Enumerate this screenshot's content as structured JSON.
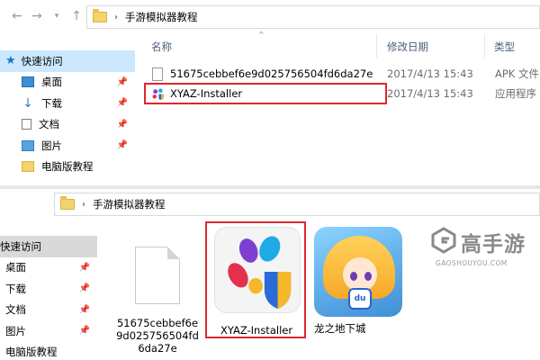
{
  "top_pane": {
    "breadcrumb": {
      "separator": "›",
      "folder": "手游模拟器教程"
    },
    "columns": {
      "name": "名称",
      "date": "修改日期",
      "type": "类型"
    },
    "nav": [
      {
        "label": "快速访问",
        "icon": "star-icon",
        "selected": true
      },
      {
        "label": "桌面",
        "icon": "desktop-icon",
        "pinned": true
      },
      {
        "label": "下载",
        "icon": "download-icon",
        "pinned": true
      },
      {
        "label": "文档",
        "icon": "document-icon",
        "pinned": true
      },
      {
        "label": "图片",
        "icon": "pictures-icon",
        "pinned": true
      },
      {
        "label": "电脑版教程",
        "icon": "folder-icon"
      }
    ],
    "files": [
      {
        "name": "51675cebbef6e9d025756504fd6da27e",
        "date": "2017/4/13 15:43",
        "type": "APK 文件"
      },
      {
        "name": "XYAZ-Installer",
        "date": "2017/4/13 15:43",
        "type": "应用程序"
      }
    ]
  },
  "bottom_pane": {
    "breadcrumb": {
      "separator": "›",
      "folder": "手游模拟器教程"
    },
    "nav": [
      {
        "label": "快速访问",
        "selected": true
      },
      {
        "label": "桌面",
        "pinned": true
      },
      {
        "label": "下载",
        "pinned": true
      },
      {
        "label": "文档",
        "pinned": true
      },
      {
        "label": "图片",
        "pinned": true
      },
      {
        "label": "电脑版教程"
      }
    ],
    "tiles": [
      {
        "label": "51675cebbef6e\n9d025756504fd\n6da27e"
      },
      {
        "label": "XYAZ-Installer"
      },
      {
        "label": "龙之地下城"
      }
    ]
  },
  "watermark": {
    "name": "高手游",
    "sub": "GAOSHOUYOU.COM"
  },
  "colors": {
    "highlight": "#e0262f",
    "selection": "#cce8ff",
    "accent": "#1a73c9"
  }
}
